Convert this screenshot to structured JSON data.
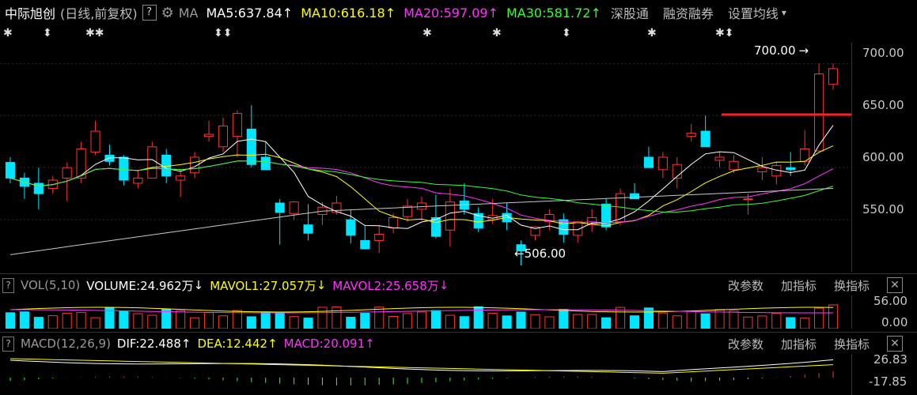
{
  "header": {
    "stock_name": "中际旭创",
    "period": "(日线,前复权)",
    "help": "?",
    "ma_label": "MA",
    "ma5": "MA5:637.84",
    "ma10": "MA10:616.18",
    "ma20": "MA20:597.09",
    "ma30": "MA30:581.72",
    "arrow": "↑",
    "link1": "深股通",
    "link2": "融资融券",
    "link3": "设置均线",
    "dropdown": "▾"
  },
  "main": {
    "marker_high": "700.00",
    "marker_low": "506.00",
    "axis": [
      "700.00",
      "650.00",
      "600.00",
      "550.00"
    ],
    "markers": [
      "✱",
      "⬍",
      "✱✱",
      "⬍⬍",
      "✱",
      "✱",
      "⬍",
      "✱",
      "✱⬍"
    ]
  },
  "vol": {
    "title": "VOL(5,10)",
    "volume": "VOLUME:24.962万",
    "mavol1": "MAVOL1:27.057万",
    "mavol2": "MAVOL2:25.658万",
    "down_arrow": "↓",
    "axis": [
      "56.00",
      "0.00"
    ]
  },
  "macd": {
    "title": "MACD(12,26,9)",
    "dif": "DIF:22.488",
    "dea": "DEA:12.442",
    "macd": "MACD:20.091",
    "up_arrow": "↑",
    "axis": [
      "26.83",
      "-17.85"
    ]
  },
  "buttons": {
    "params": "改参数",
    "add_indicator": "加指标",
    "switch_indicator": "换指标",
    "close": "✕"
  },
  "colors": {
    "up": "#ff3333",
    "down": "#00e5ff",
    "ma5": "#ffffff",
    "ma10": "#ffff00",
    "ma20": "#ff33ff",
    "ma30": "#33ff33",
    "ma60": "#c8c8c8"
  },
  "chart_data": {
    "type": "candlestick",
    "y_range": [
      500,
      720
    ],
    "candles": [
      {
        "o": 605,
        "h": 610,
        "l": 585,
        "c": 590
      },
      {
        "o": 590,
        "h": 595,
        "l": 570,
        "c": 582
      },
      {
        "o": 585,
        "h": 600,
        "l": 560,
        "c": 575
      },
      {
        "o": 580,
        "h": 592,
        "l": 575,
        "c": 588
      },
      {
        "o": 590,
        "h": 605,
        "l": 568,
        "c": 600
      },
      {
        "o": 590,
        "h": 625,
        "l": 585,
        "c": 618
      },
      {
        "o": 615,
        "h": 645,
        "l": 612,
        "c": 635
      },
      {
        "o": 612,
        "h": 622,
        "l": 602,
        "c": 606
      },
      {
        "o": 610,
        "h": 612,
        "l": 583,
        "c": 588
      },
      {
        "o": 585,
        "h": 598,
        "l": 580,
        "c": 590
      },
      {
        "o": 590,
        "h": 625,
        "l": 590,
        "c": 620
      },
      {
        "o": 612,
        "h": 618,
        "l": 585,
        "c": 592
      },
      {
        "o": 588,
        "h": 598,
        "l": 572,
        "c": 592
      },
      {
        "o": 595,
        "h": 615,
        "l": 590,
        "c": 610
      },
      {
        "o": 630,
        "h": 645,
        "l": 625,
        "c": 632
      },
      {
        "o": 620,
        "h": 648,
        "l": 615,
        "c": 640
      },
      {
        "o": 630,
        "h": 655,
        "l": 610,
        "c": 652
      },
      {
        "o": 637,
        "h": 660,
        "l": 600,
        "c": 603
      },
      {
        "o": 610,
        "h": 625,
        "l": 598,
        "c": 598
      },
      {
        "o": 566,
        "h": 570,
        "l": 526,
        "c": 557
      },
      {
        "o": 556,
        "h": 568,
        "l": 550,
        "c": 567
      },
      {
        "o": 545,
        "h": 565,
        "l": 530,
        "c": 537
      },
      {
        "o": 555,
        "h": 567,
        "l": 545,
        "c": 562
      },
      {
        "o": 557,
        "h": 573,
        "l": 555,
        "c": 566
      },
      {
        "o": 550,
        "h": 560,
        "l": 527,
        "c": 535
      },
      {
        "o": 530,
        "h": 545,
        "l": 524,
        "c": 522
      },
      {
        "o": 530,
        "h": 545,
        "l": 518,
        "c": 536
      },
      {
        "o": 542,
        "h": 556,
        "l": 537,
        "c": 552
      },
      {
        "o": 553,
        "h": 570,
        "l": 548,
        "c": 563
      },
      {
        "o": 560,
        "h": 572,
        "l": 549,
        "c": 566
      },
      {
        "o": 552,
        "h": 574,
        "l": 532,
        "c": 534
      },
      {
        "o": 540,
        "h": 580,
        "l": 524,
        "c": 567
      },
      {
        "o": 568,
        "h": 585,
        "l": 555,
        "c": 560
      },
      {
        "o": 556,
        "h": 562,
        "l": 538,
        "c": 542
      },
      {
        "o": 550,
        "h": 570,
        "l": 546,
        "c": 554
      },
      {
        "o": 556,
        "h": 566,
        "l": 540,
        "c": 548
      },
      {
        "o": 526,
        "h": 530,
        "l": 506,
        "c": 520
      },
      {
        "o": 535,
        "h": 544,
        "l": 530,
        "c": 543
      },
      {
        "o": 548,
        "h": 560,
        "l": 540,
        "c": 555
      },
      {
        "o": 550,
        "h": 556,
        "l": 528,
        "c": 536
      },
      {
        "o": 535,
        "h": 540,
        "l": 528,
        "c": 548
      },
      {
        "o": 545,
        "h": 560,
        "l": 538,
        "c": 552
      },
      {
        "o": 565,
        "h": 570,
        "l": 540,
        "c": 543
      },
      {
        "o": 548,
        "h": 580,
        "l": 545,
        "c": 575
      },
      {
        "o": 575,
        "h": 585,
        "l": 570,
        "c": 570
      },
      {
        "o": 610,
        "h": 620,
        "l": 600,
        "c": 600
      },
      {
        "o": 598,
        "h": 615,
        "l": 590,
        "c": 610
      },
      {
        "o": 590,
        "h": 610,
        "l": 580,
        "c": 603
      },
      {
        "o": 630,
        "h": 642,
        "l": 625,
        "c": 633
      },
      {
        "o": 635,
        "h": 650,
        "l": 625,
        "c": 620
      },
      {
        "o": 607,
        "h": 615,
        "l": 600,
        "c": 610
      },
      {
        "o": 598,
        "h": 612,
        "l": 595,
        "c": 606
      },
      {
        "o": 570,
        "h": 575,
        "l": 555,
        "c": 570
      },
      {
        "o": 596,
        "h": 610,
        "l": 588,
        "c": 600
      },
      {
        "o": 592,
        "h": 605,
        "l": 584,
        "c": 602
      },
      {
        "o": 600,
        "h": 615,
        "l": 592,
        "c": 598
      },
      {
        "o": 606,
        "h": 636,
        "l": 602,
        "c": 618
      },
      {
        "o": 616,
        "h": 700,
        "l": 648,
        "c": 690
      },
      {
        "o": 680,
        "h": 700,
        "l": 675,
        "c": 695
      }
    ],
    "volume_range": [
      0,
      60
    ],
    "macd_range": [
      -17.85,
      26.83
    ]
  }
}
